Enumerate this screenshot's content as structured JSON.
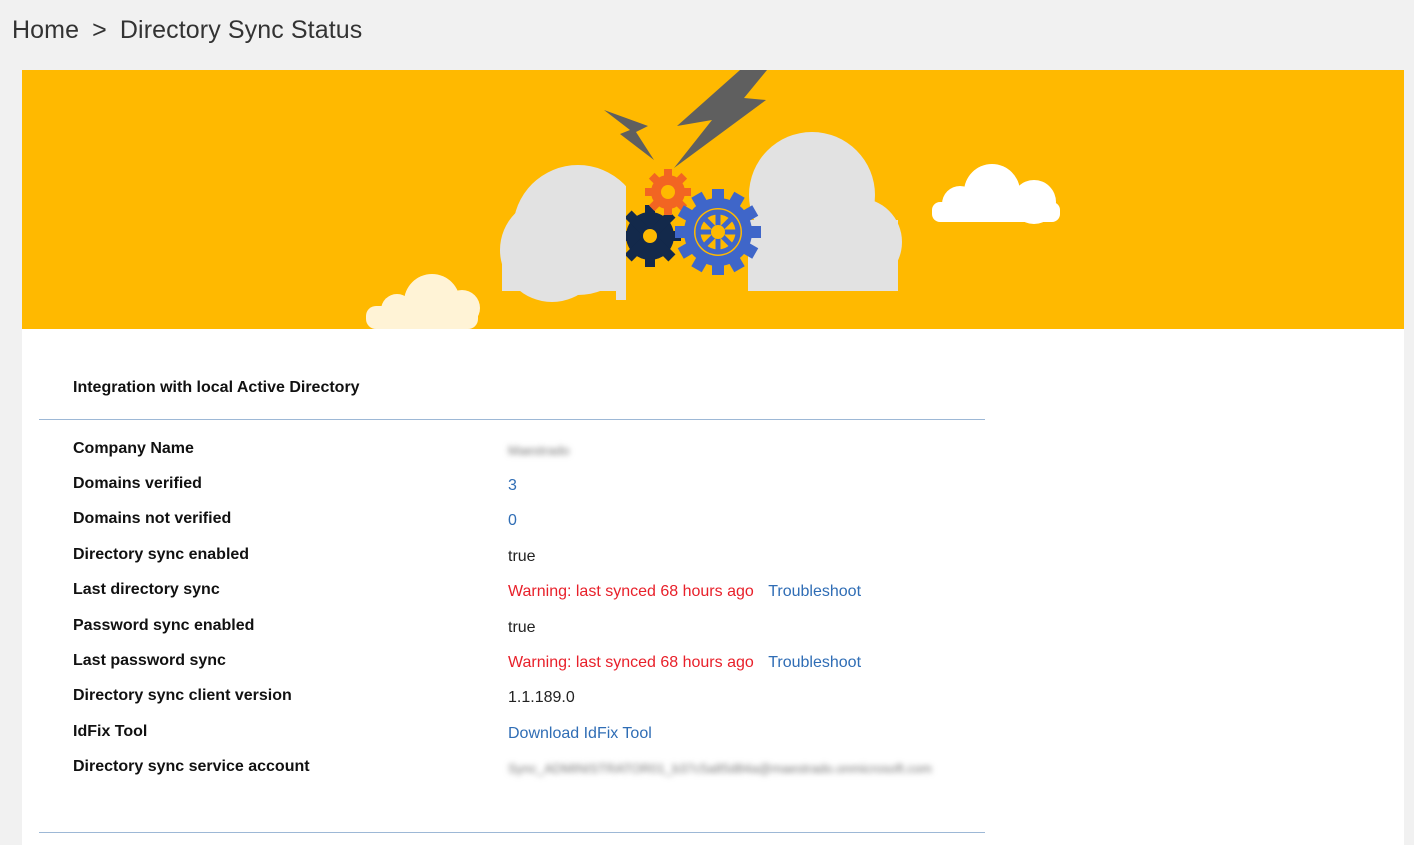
{
  "breadcrumb": {
    "home": "Home",
    "separator": ">",
    "current": "Directory Sync Status"
  },
  "banner": {
    "background": "#ffb900",
    "illustration": "clouds-gears-lightning"
  },
  "section": {
    "title": "Integration with local Active Directory"
  },
  "rows": [
    {
      "label": "Company Name",
      "value": "Maestrado",
      "type": "redacted"
    },
    {
      "label": "Domains verified",
      "value": "3",
      "type": "link"
    },
    {
      "label": "Domains not verified",
      "value": "0",
      "type": "link"
    },
    {
      "label": "Directory sync enabled",
      "value": "true",
      "type": "text"
    },
    {
      "label": "Last directory sync",
      "value": "Warning: last synced 68 hours ago",
      "action": "Troubleshoot",
      "type": "warning"
    },
    {
      "label": "Password sync enabled",
      "value": "true",
      "type": "text"
    },
    {
      "label": "Last password sync",
      "value": "Warning: last synced 68 hours ago",
      "action": "Troubleshoot",
      "type": "warning"
    },
    {
      "label": "Directory sync client version",
      "value": "1.1.189.0",
      "type": "text"
    },
    {
      "label": "IdFix Tool",
      "value": "Download IdFix Tool",
      "type": "link"
    },
    {
      "label": "Directory sync service account",
      "value": "Sync_ADMINISTRATOR01_b37c5a85d84a@maestrado.onmicrosoft.com",
      "type": "redacted"
    }
  ],
  "colors": {
    "link": "#2f6db5",
    "warning": "#e8202a",
    "rule": "#9db8d6"
  }
}
